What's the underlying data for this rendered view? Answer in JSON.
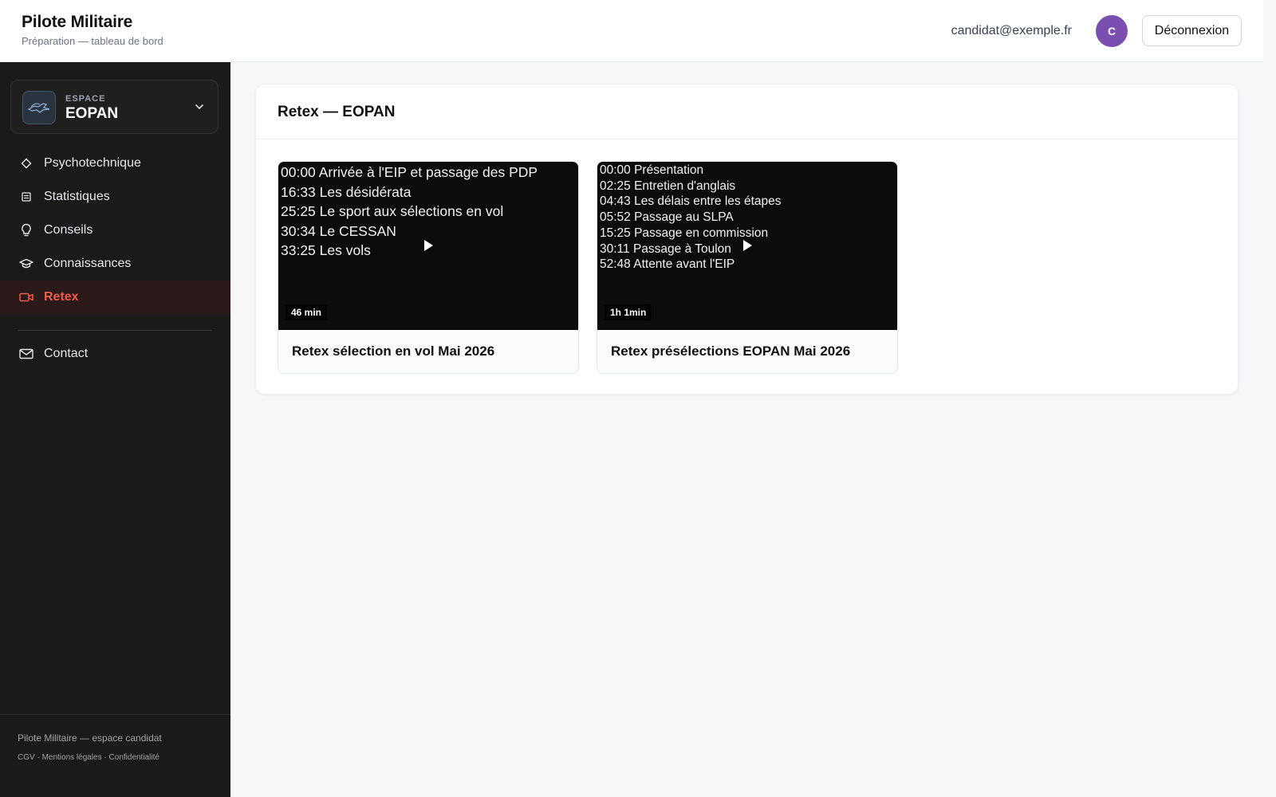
{
  "header": {
    "title": "Pilote Militaire",
    "subtitle": "Préparation — tableau de bord",
    "user_email": "candidat@exemple.fr",
    "avatar_initial": "C",
    "logout_label": "Déconnexion"
  },
  "sidebar": {
    "space": {
      "kicker": "ESPACE",
      "name": "EOPAN"
    },
    "items": [
      {
        "label": "Psychotechnique",
        "icon": "diamond-icon"
      },
      {
        "label": "Statistiques",
        "icon": "list-icon"
      },
      {
        "label": "Conseils",
        "icon": "lightbulb-icon"
      },
      {
        "label": "Connaissances",
        "icon": "graduation-cap-icon"
      },
      {
        "label": "Retex",
        "icon": "video-camera-icon",
        "active": true
      }
    ],
    "contact": {
      "label": "Contact",
      "icon": "mail-icon"
    },
    "footer": {
      "title": "Pilote Militaire — espace candidat",
      "links": [
        "CGV",
        "Mentions légales",
        "Confidentialité"
      ],
      "separator": "·"
    }
  },
  "main": {
    "title": "Retex — EOPAN",
    "videos": [
      {
        "title": "Retex sélection en vol Mai 2026",
        "duration": "46 min",
        "chapters": [
          "00:00 Arrivée à l'EIP et passage des PDP",
          "16:33 Les désidérata",
          "25:25 Le sport aux sélections en vol",
          "30:34 Le CESSAN",
          "33:25 Les vols"
        ]
      },
      {
        "title": "Retex présélections EOPAN Mai 2026",
        "duration": "1h 1min",
        "chapters": [
          "00:00 Présentation",
          "02:25 Entretien d'anglais",
          "04:43 Les délais entre les étapes",
          "05:52 Passage au SLPA",
          "15:25 Passage en commission",
          "30:11 Passage à Toulon",
          "52:48 Attente avant l'EIP"
        ]
      }
    ]
  },
  "colors": {
    "accent": "#ef5a4a",
    "sidebar_bg": "#1a1a1a",
    "avatar_bg": "#7a4fb0"
  }
}
